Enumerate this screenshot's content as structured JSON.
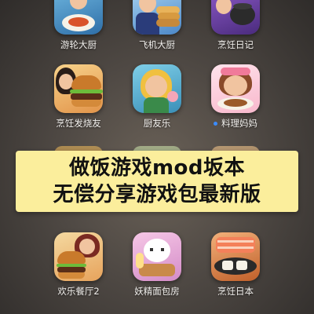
{
  "apps": [
    {
      "id": "cruise",
      "label": "游轮大厨",
      "has_dot": false
    },
    {
      "id": "airplane",
      "label": "飞机大厨",
      "has_dot": false
    },
    {
      "id": "diary",
      "label": "烹饪日记",
      "has_dot": false
    },
    {
      "id": "fever",
      "label": "烹饪发烧友",
      "has_dot": false
    },
    {
      "id": "friends",
      "label": "厨友乐",
      "has_dot": false
    },
    {
      "id": "mama",
      "label": "料理妈妈",
      "has_dot": true
    },
    {
      "id": "happy",
      "label": "欢乐餐厅2",
      "has_dot": false
    },
    {
      "id": "bakery",
      "label": "妖精面包房",
      "has_dot": false
    },
    {
      "id": "japan",
      "label": "烹饪日本",
      "has_dot": false
    }
  ],
  "banner": {
    "line1": "做饭游戏mod坂本",
    "line2": "无偿分享游戏包最新版"
  },
  "colors": {
    "banner_bg": "#fbee9c",
    "dot": "#3b8cff",
    "label": "#f3f1ee"
  }
}
